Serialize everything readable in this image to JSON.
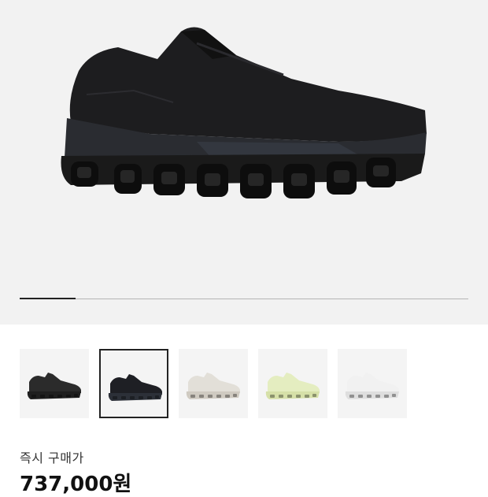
{
  "product": {
    "main_image_icon": "black-running-shoe-image",
    "gallery_progress_fraction": 0.125,
    "thumbnails": [
      {
        "name": "thumbnail-black-dark-shoe",
        "color": "#2b2b2b",
        "sole": "#1f1f1f",
        "selected": false
      },
      {
        "name": "thumbnail-black-navy-shoe",
        "color": "#1e1f24",
        "sole": "#2c3038",
        "selected": true
      },
      {
        "name": "thumbnail-white-grey-shoe",
        "color": "#e2dfd8",
        "sole": "#cfcac1",
        "selected": false
      },
      {
        "name": "thumbnail-lime-shoe",
        "color": "#e4edc0",
        "sole": "#d6e0a8",
        "selected": false
      },
      {
        "name": "thumbnail-white-shoe",
        "color": "#f1f1f1",
        "sole": "#dedede",
        "selected": false
      }
    ],
    "buy_label": "즉시 구매가",
    "price": "737,000원"
  },
  "colors": {
    "accent": "#222222",
    "hero_background": "#f2f2f2"
  }
}
